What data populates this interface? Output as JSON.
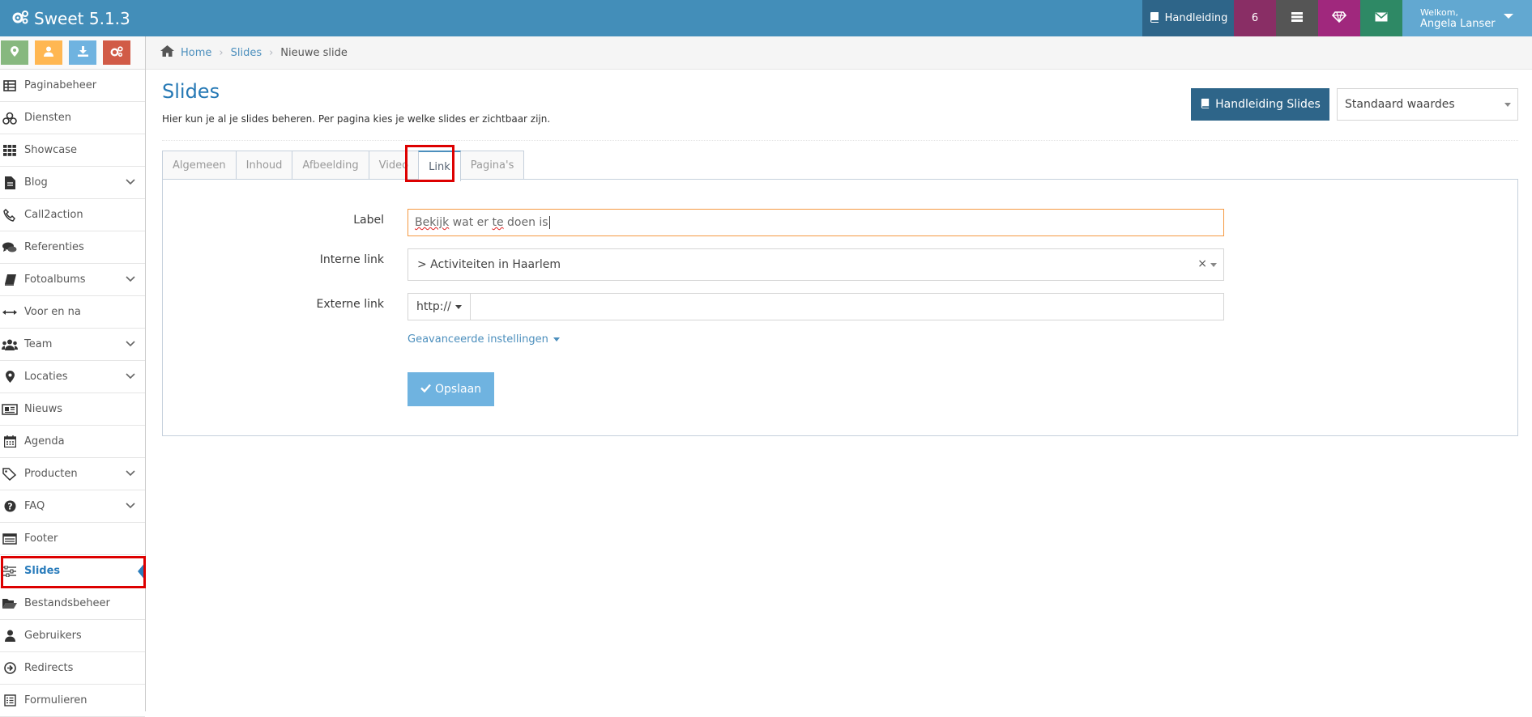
{
  "app": {
    "title": "Sweet 5.1.3"
  },
  "navbar": {
    "manual_label": "Handleiding",
    "badge_count": "6",
    "user_welcome": "Welkom,",
    "user_name": "Angela Lanser",
    "colors": {
      "bar": "#438eb9",
      "manual": "#2e6589",
      "count": "#892e65",
      "cms": "#555555",
      "gem": "#a0287d",
      "mail": "#2e8965",
      "user": "#62a8d1"
    }
  },
  "shortcuts": [
    {
      "icon": "map-marker-icon",
      "color": "#87b87f"
    },
    {
      "icon": "user-icon",
      "color": "#ffb752"
    },
    {
      "icon": "download-icon",
      "color": "#6fb3e0"
    },
    {
      "icon": "cogs-icon",
      "color": "#d15b47"
    }
  ],
  "sidebar": {
    "items": [
      {
        "label": "Paginabeheer",
        "icon": "table-icon",
        "chevron": false
      },
      {
        "label": "Diensten",
        "icon": "cubes-icon",
        "chevron": false
      },
      {
        "label": "Showcase",
        "icon": "grid-icon",
        "chevron": false
      },
      {
        "label": "Blog",
        "icon": "file-icon",
        "chevron": true
      },
      {
        "label": "Call2action",
        "icon": "phone-icon",
        "chevron": false
      },
      {
        "label": "Referenties",
        "icon": "comments-icon",
        "chevron": false
      },
      {
        "label": "Fotoalbums",
        "icon": "book-icon",
        "chevron": true
      },
      {
        "label": "Voor en na",
        "icon": "arrows-h-icon",
        "chevron": false
      },
      {
        "label": "Team",
        "icon": "users-icon",
        "chevron": true
      },
      {
        "label": "Locaties",
        "icon": "map-marker-icon",
        "chevron": true
      },
      {
        "label": "Nieuws",
        "icon": "newspaper-icon",
        "chevron": false
      },
      {
        "label": "Agenda",
        "icon": "calendar-icon",
        "chevron": false
      },
      {
        "label": "Producten",
        "icon": "tags-icon",
        "chevron": true
      },
      {
        "label": "FAQ",
        "icon": "question-circle-icon",
        "chevron": true
      },
      {
        "label": "Footer",
        "icon": "footer-icon",
        "chevron": false
      },
      {
        "label": "Slides",
        "icon": "sliders-icon",
        "chevron": false,
        "active": true
      },
      {
        "label": "Bestandsbeheer",
        "icon": "folder-open-icon",
        "chevron": false
      },
      {
        "label": "Gebruikers",
        "icon": "user-icon",
        "chevron": false
      },
      {
        "label": "Redirects",
        "icon": "arrow-circle-right-icon",
        "chevron": false
      },
      {
        "label": "Formulieren",
        "icon": "form-icon",
        "chevron": false
      }
    ]
  },
  "breadcrumb": {
    "home": "Home",
    "section": "Slides",
    "current": "Nieuwe slide"
  },
  "header": {
    "title": "Slides",
    "subtitle": "Hier kun je al je slides beheren. Per pagina kies je welke slides er zichtbaar zijn.",
    "manual_button": "Handleiding Slides",
    "defaults_select": "Standaard waardes"
  },
  "tabs": [
    {
      "label": "Algemeen"
    },
    {
      "label": "Inhoud"
    },
    {
      "label": "Afbeelding"
    },
    {
      "label": "Video"
    },
    {
      "label": "Link",
      "active": true
    },
    {
      "label": "Pagina's"
    }
  ],
  "form": {
    "label_field": {
      "label": "Label",
      "value_part1": "Bekijk",
      "value_part2": " wat er ",
      "value_part3": "te",
      "value_part4": " doen is"
    },
    "internal_link": {
      "label": "Interne link",
      "value": "> Activiteiten in Haarlem",
      "clear": "×"
    },
    "external_link": {
      "label": "Externe link",
      "protocol": "http://",
      "value": ""
    },
    "advanced": "Geavanceerde instellingen",
    "save": "Opslaan"
  }
}
